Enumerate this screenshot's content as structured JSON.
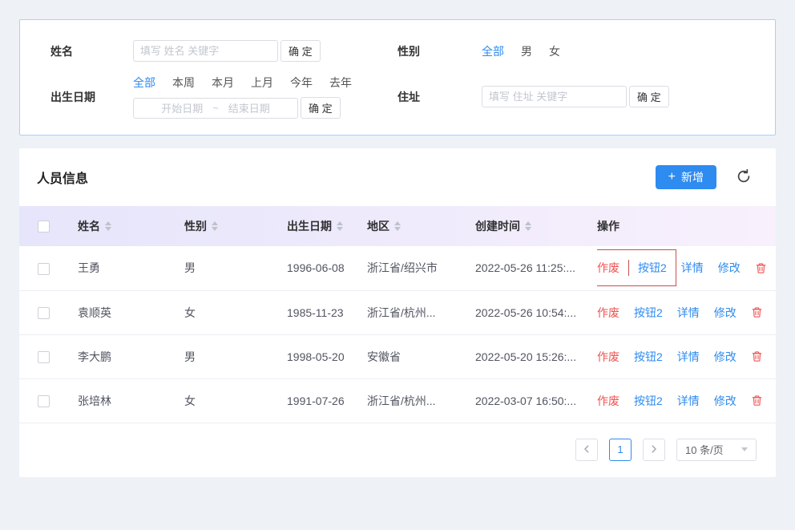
{
  "filters": {
    "name": {
      "label": "姓名",
      "placeholder": "填写 姓名 关键字",
      "confirm_label": "确 定"
    },
    "gender": {
      "label": "性别",
      "options": [
        "全部",
        "男",
        "女"
      ],
      "selected": "全部"
    },
    "birth_date": {
      "label": "出生日期",
      "quick_options": [
        "全部",
        "本周",
        "本月",
        "上月",
        "今年",
        "去年"
      ],
      "selected": "全部",
      "start_placeholder": "开始日期",
      "range_separator": "~",
      "end_placeholder": "结束日期",
      "confirm_label": "确 定"
    },
    "address": {
      "label": "住址",
      "placeholder": "填写 住址 关键字",
      "confirm_label": "确 定"
    }
  },
  "panel": {
    "title": "人员信息",
    "add_button_label": "新增",
    "plus_glyph": "+"
  },
  "icons": {
    "add": "plus-icon",
    "refresh": "refresh-icon",
    "delete": "trash-icon",
    "prev": "chevron-left-icon",
    "next": "chevron-right-icon",
    "page_size": "chevron-down-icon",
    "sort": "sort-caret-icon"
  },
  "table": {
    "select_all_checked": false,
    "columns": [
      {
        "label": "姓名",
        "sortable": true
      },
      {
        "label": "性别",
        "sortable": true
      },
      {
        "label": "出生日期",
        "sortable": true
      },
      {
        "label": "地区",
        "sortable": true
      },
      {
        "label": "创建时间",
        "sortable": true
      },
      {
        "label": "操作",
        "sortable": false
      }
    ],
    "action_labels": {
      "invalidate": "作废",
      "button2": "按钮2",
      "detail": "详情",
      "edit": "修改"
    },
    "rows": [
      {
        "name": "王勇",
        "gender": "男",
        "birth_date": "1996-06-08",
        "region": "浙江省/绍兴市",
        "created_at": "2022-05-26 11:25:...",
        "checked": false,
        "highlight_actions": true
      },
      {
        "name": "袁顺英",
        "gender": "女",
        "birth_date": "1985-11-23",
        "region": "浙江省/杭州...",
        "created_at": "2022-05-26 10:54:...",
        "checked": false,
        "highlight_actions": false
      },
      {
        "name": "李大鹏",
        "gender": "男",
        "birth_date": "1998-05-20",
        "region": "安徽省",
        "created_at": "2022-05-20 15:26:...",
        "checked": false,
        "highlight_actions": false
      },
      {
        "name": "张培林",
        "gender": "女",
        "birth_date": "1991-07-26",
        "region": "浙江省/杭州...",
        "created_at": "2022-03-07 16:50:...",
        "checked": false,
        "highlight_actions": false
      }
    ]
  },
  "pagination": {
    "current_page": "1",
    "page_size": "10 条/页"
  },
  "colors": {
    "accent_blue": "#2e8bf0",
    "danger_red": "#f05353",
    "highlight_border": "#c94f4f",
    "filter_border": "#a6d1ff",
    "header_gradient_start": "#e6e5fb",
    "header_gradient_end": "#f8f0fc"
  }
}
